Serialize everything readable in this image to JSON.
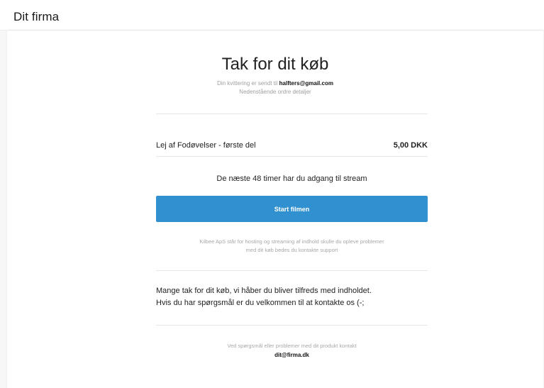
{
  "brand": {
    "name": "Dit firma"
  },
  "receipt": {
    "title": "Tak for dit køb",
    "sent_prefix": "Din kvittering er sendt til",
    "email": "halfters@gmail.com",
    "details_caption": "Nedenstående ordre detaljer"
  },
  "order": {
    "item_name": "Lej af Fodøvelser - første del",
    "price": "5,00 DKK"
  },
  "access": {
    "text": "De næste 48 timer har du adgang til stream",
    "button_label": "Start filmen"
  },
  "support_note": {
    "line1": "Kilbee ApS står for hosting og streaming af indhold skulle du opleve problemer",
    "line2": "med dit køb bedes du kontakte support"
  },
  "thanks": {
    "line1": "Mange tak for dit køb, vi håber du bliver tilfreds med indholdet.",
    "line2": "Hvis du har spørgsmål er du velkommen til at kontakte os (-;"
  },
  "footer": {
    "text": "Ved spørgsmål eller problemer med dit produkt kontakt",
    "email": "dit@firma.dk"
  },
  "colors": {
    "button": "#3190cf",
    "background": "#f7f7f7",
    "card": "#ffffff"
  }
}
